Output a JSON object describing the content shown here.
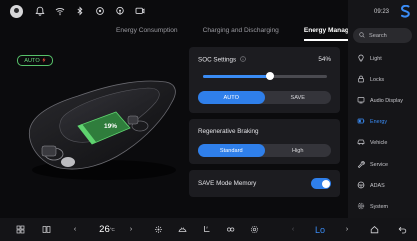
{
  "status_bar": {
    "icons": [
      "avatar",
      "bell-icon",
      "wifi-icon",
      "bluetooth-icon",
      "location-icon",
      "hotspot-icon",
      "screen-cast-icon"
    ]
  },
  "time": "09:23",
  "tabs": [
    {
      "label": "Energy Consumption",
      "active": false
    },
    {
      "label": "Charging and Discharging",
      "active": false
    },
    {
      "label": "Energy Manager",
      "active": true
    }
  ],
  "sidebar": {
    "search_placeholder": "Search",
    "items": [
      {
        "label": "Light",
        "icon": "light-icon"
      },
      {
        "label": "Locks",
        "icon": "lock-icon"
      },
      {
        "label": "Audio Display",
        "icon": "audio-display-icon"
      },
      {
        "label": "Energy",
        "icon": "battery-icon",
        "active": true
      },
      {
        "label": "Vehicle",
        "icon": "car-icon"
      },
      {
        "label": "Service",
        "icon": "wrench-icon"
      },
      {
        "label": "ADAS",
        "icon": "adas-icon"
      },
      {
        "label": "System",
        "icon": "gear-icon"
      }
    ]
  },
  "car": {
    "mode_badge": "AUTO",
    "battery_percent_label": "19%",
    "battery_level": 0.19
  },
  "soc": {
    "title": "SOC Settings",
    "value_label": "54%",
    "level": 0.54,
    "mode_auto": "AUTO",
    "mode_save": "SAVE",
    "selected": "AUTO"
  },
  "regen": {
    "title": "Regenerative Braking",
    "option_standard": "Standard",
    "option_high": "High",
    "selected": "Standard"
  },
  "save_mode": {
    "title": "SAVE Mode Memory",
    "enabled": true
  },
  "dock": {
    "temperature": "26",
    "temperature_unit": "°C",
    "fan_label": "Lo"
  },
  "colors": {
    "accent": "#2f7fea",
    "auto_badge": "#57c26a",
    "background": "#0b0b0d",
    "panel": "#1c1c20"
  }
}
